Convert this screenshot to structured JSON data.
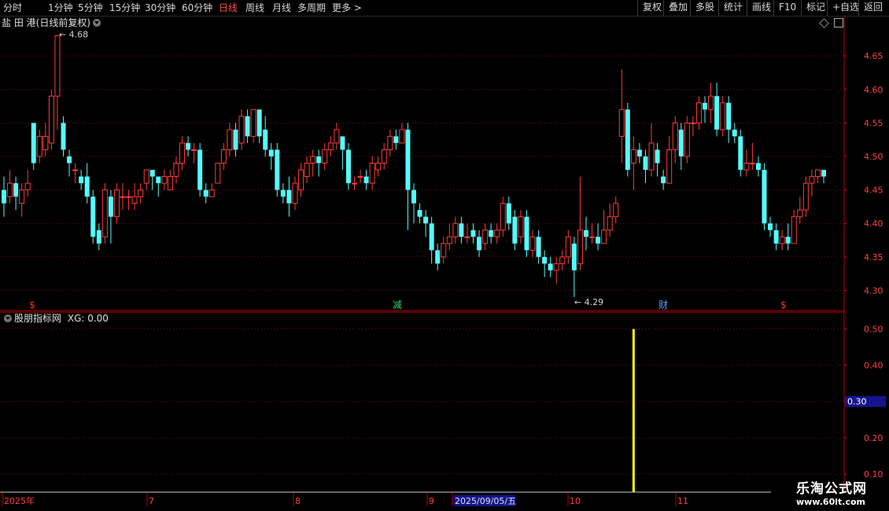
{
  "toolbar": {
    "periods": [
      "分时",
      "1分钟",
      "5分钟",
      "15分钟",
      "30分钟",
      "60分钟",
      "日线",
      "周线",
      "月线",
      "多周期",
      "更多"
    ],
    "active_period": "日线",
    "more_glyph": ">",
    "right_buttons": [
      "复权",
      "叠加",
      "多股",
      "统计",
      "画线",
      "F10",
      "标记",
      "+自选",
      "返回"
    ]
  },
  "main_chart": {
    "stock_name": "盐 田 港",
    "chart_mode": "(日线前复权)",
    "high_marker": "4.68",
    "low_marker": "4.29",
    "y_axis_ticks": [
      "4.65",
      "4.60",
      "4.55",
      "4.50",
      "4.45",
      "4.40",
      "4.35",
      "4.30"
    ],
    "event_markers": [
      {
        "text": "$",
        "color": "#ff3030"
      },
      {
        "text": "减",
        "color": "#35d56f"
      },
      {
        "text": "财",
        "color": "#4fa3ff"
      },
      {
        "text": "$",
        "color": "#ff3030"
      }
    ],
    "colors": {
      "up": "#ff3b3b",
      "down": "#54fcfc",
      "grid": "#7a1010",
      "axis": "#b40000"
    }
  },
  "indicator": {
    "name": "股朋指标网",
    "value_label": "XG: 0.00",
    "y_axis_ticks": [
      "0.50",
      "0.40",
      "0.30",
      "0.20",
      "0.10"
    ],
    "current_value_badge": "0.30",
    "signal_color": "#ffff00"
  },
  "date_axis": {
    "labels": [
      "2025年",
      "7",
      "8",
      "9",
      "2025/09/05/五",
      "10",
      "11"
    ]
  },
  "watermark": {
    "line1": "乐淘公式网",
    "line2": "www.60lt.com"
  },
  "chart_data": {
    "type": "candlestick",
    "y_range": [
      4.27,
      4.71
    ],
    "candles": [
      [
        4.45,
        4.43,
        4.47,
        4.41
      ],
      [
        4.44,
        4.46,
        4.48,
        4.43
      ],
      [
        4.46,
        4.44,
        4.47,
        4.42
      ],
      [
        4.43,
        4.45,
        4.46,
        4.41
      ],
      [
        4.45,
        4.46,
        4.48,
        4.44
      ],
      [
        4.55,
        4.49,
        4.55,
        4.48
      ],
      [
        4.5,
        4.53,
        4.54,
        4.49
      ],
      [
        4.51,
        4.53,
        4.55,
        4.5
      ],
      [
        4.52,
        4.59,
        4.6,
        4.51
      ],
      [
        4.59,
        4.68,
        4.68,
        4.54
      ],
      [
        4.55,
        4.51,
        4.56,
        4.5
      ],
      [
        4.5,
        4.49,
        4.51,
        4.47
      ],
      [
        4.48,
        4.48,
        4.49,
        4.46
      ],
      [
        4.47,
        4.46,
        4.48,
        4.45
      ],
      [
        4.47,
        4.44,
        4.49,
        4.43
      ],
      [
        4.44,
        4.38,
        4.45,
        4.37
      ],
      [
        4.39,
        4.37,
        4.4,
        4.36
      ],
      [
        4.38,
        4.45,
        4.46,
        4.37
      ],
      [
        4.44,
        4.41,
        4.45,
        4.37
      ],
      [
        4.41,
        4.45,
        4.46,
        4.4
      ],
      [
        4.44,
        4.44,
        4.46,
        4.42
      ],
      [
        4.44,
        4.44,
        4.45,
        4.42
      ],
      [
        4.43,
        4.44,
        4.46,
        4.42
      ],
      [
        4.44,
        4.45,
        4.46,
        4.43
      ],
      [
        4.46,
        4.48,
        4.48,
        4.45
      ],
      [
        4.48,
        4.47,
        4.48,
        4.45
      ],
      [
        4.47,
        4.46,
        4.47,
        4.44
      ],
      [
        4.46,
        4.47,
        4.48,
        4.45
      ],
      [
        4.45,
        4.47,
        4.48,
        4.45
      ],
      [
        4.47,
        4.49,
        4.5,
        4.46
      ],
      [
        4.49,
        4.52,
        4.53,
        4.48
      ],
      [
        4.52,
        4.51,
        4.53,
        4.5
      ],
      [
        4.51,
        4.51,
        4.52,
        4.49
      ],
      [
        4.51,
        4.45,
        4.52,
        4.44
      ],
      [
        4.45,
        4.44,
        4.46,
        4.43
      ],
      [
        4.44,
        4.45,
        4.46,
        4.44
      ],
      [
        4.46,
        4.49,
        4.49,
        4.46
      ],
      [
        4.49,
        4.51,
        4.52,
        4.48
      ],
      [
        4.51,
        4.54,
        4.55,
        4.5
      ],
      [
        4.54,
        4.51,
        4.55,
        4.5
      ],
      [
        4.52,
        4.56,
        4.57,
        4.51
      ],
      [
        4.56,
        4.53,
        4.57,
        4.52
      ],
      [
        4.53,
        4.57,
        4.57,
        4.52
      ],
      [
        4.57,
        4.53,
        4.57,
        4.52
      ],
      [
        4.54,
        4.51,
        4.56,
        4.5
      ],
      [
        4.51,
        4.5,
        4.52,
        4.48
      ],
      [
        4.51,
        4.45,
        4.52,
        4.44
      ],
      [
        4.45,
        4.44,
        4.46,
        4.43
      ],
      [
        4.45,
        4.43,
        4.47,
        4.41
      ],
      [
        4.43,
        4.46,
        4.47,
        4.42
      ],
      [
        4.45,
        4.48,
        4.49,
        4.44
      ],
      [
        4.47,
        4.49,
        4.5,
        4.46
      ],
      [
        4.49,
        4.5,
        4.51,
        4.47
      ],
      [
        4.5,
        4.49,
        4.51,
        4.47
      ],
      [
        4.49,
        4.51,
        4.52,
        4.48
      ],
      [
        4.51,
        4.52,
        4.53,
        4.5
      ],
      [
        4.52,
        4.54,
        4.55,
        4.51
      ],
      [
        4.53,
        4.51,
        4.53,
        4.48
      ],
      [
        4.51,
        4.46,
        4.52,
        4.45
      ],
      [
        4.46,
        4.46,
        4.47,
        4.45
      ],
      [
        4.47,
        4.47,
        4.48,
        4.46
      ],
      [
        4.47,
        4.46,
        4.48,
        4.45
      ],
      [
        4.46,
        4.49,
        4.5,
        4.45
      ],
      [
        4.48,
        4.49,
        4.5,
        4.47
      ],
      [
        4.49,
        4.51,
        4.52,
        4.48
      ],
      [
        4.51,
        4.53,
        4.54,
        4.5
      ],
      [
        4.53,
        4.52,
        4.54,
        4.51
      ],
      [
        4.52,
        4.54,
        4.55,
        4.52
      ],
      [
        4.54,
        4.45,
        4.55,
        4.39
      ],
      [
        4.45,
        4.43,
        4.46,
        4.4
      ],
      [
        4.42,
        4.41,
        4.43,
        4.4
      ],
      [
        4.41,
        4.4,
        4.42,
        4.38
      ],
      [
        4.4,
        4.36,
        4.41,
        4.34
      ],
      [
        4.36,
        4.34,
        4.37,
        4.33
      ],
      [
        4.35,
        4.37,
        4.38,
        4.34
      ],
      [
        4.37,
        4.38,
        4.4,
        4.36
      ],
      [
        4.38,
        4.4,
        4.41,
        4.37
      ],
      [
        4.4,
        4.38,
        4.41,
        4.37
      ],
      [
        4.38,
        4.38,
        4.4,
        4.37
      ],
      [
        4.39,
        4.38,
        4.4,
        4.37
      ],
      [
        4.38,
        4.36,
        4.39,
        4.35
      ],
      [
        4.37,
        4.39,
        4.4,
        4.36
      ],
      [
        4.39,
        4.38,
        4.4,
        4.37
      ],
      [
        4.38,
        4.39,
        4.4,
        4.37
      ],
      [
        4.39,
        4.43,
        4.44,
        4.38
      ],
      [
        4.43,
        4.4,
        4.44,
        4.39
      ],
      [
        4.41,
        4.37,
        4.42,
        4.36
      ],
      [
        4.38,
        4.41,
        4.42,
        4.37
      ],
      [
        4.41,
        4.36,
        4.42,
        4.35
      ],
      [
        4.36,
        4.38,
        4.39,
        4.35
      ],
      [
        4.38,
        4.35,
        4.39,
        4.34
      ],
      [
        4.35,
        4.34,
        4.36,
        4.32
      ],
      [
        4.34,
        4.33,
        4.35,
        4.32
      ],
      [
        4.33,
        4.34,
        4.35,
        4.31
      ],
      [
        4.34,
        4.35,
        4.36,
        4.33
      ],
      [
        4.35,
        4.38,
        4.39,
        4.34
      ],
      [
        4.37,
        4.33,
        4.38,
        4.29
      ],
      [
        4.34,
        4.39,
        4.47,
        4.33
      ],
      [
        4.39,
        4.38,
        4.41,
        4.36
      ],
      [
        4.38,
        4.38,
        4.4,
        4.37
      ],
      [
        4.38,
        4.37,
        4.4,
        4.36
      ],
      [
        4.37,
        4.39,
        4.42,
        4.37
      ],
      [
        4.39,
        4.41,
        4.43,
        4.38
      ],
      [
        4.41,
        4.43,
        4.44,
        4.4
      ],
      [
        4.53,
        4.57,
        4.63,
        4.49
      ],
      [
        4.57,
        4.48,
        4.58,
        4.47
      ],
      [
        4.49,
        4.51,
        4.53,
        4.45
      ],
      [
        4.51,
        4.5,
        4.52,
        4.49
      ],
      [
        4.5,
        4.48,
        4.51,
        4.46
      ],
      [
        4.48,
        4.52,
        4.55,
        4.47
      ],
      [
        4.51,
        4.49,
        4.52,
        4.47
      ],
      [
        4.47,
        4.46,
        4.48,
        4.45
      ],
      [
        4.46,
        4.51,
        4.53,
        4.46
      ],
      [
        4.51,
        4.55,
        4.56,
        4.49
      ],
      [
        4.54,
        4.5,
        4.55,
        4.48
      ],
      [
        4.5,
        4.55,
        4.56,
        4.49
      ],
      [
        4.55,
        4.55,
        4.56,
        4.53
      ],
      [
        4.55,
        4.58,
        4.59,
        4.54
      ],
      [
        4.58,
        4.57,
        4.59,
        4.55
      ],
      [
        4.57,
        4.59,
        4.61,
        4.55
      ],
      [
        4.59,
        4.54,
        4.61,
        4.53
      ],
      [
        4.54,
        4.58,
        4.59,
        4.53
      ],
      [
        4.58,
        4.54,
        4.59,
        4.52
      ],
      [
        4.54,
        4.53,
        4.55,
        4.52
      ],
      [
        4.53,
        4.48,
        4.54,
        4.47
      ],
      [
        4.48,
        4.49,
        4.51,
        4.47
      ],
      [
        4.49,
        4.49,
        4.52,
        4.48
      ],
      [
        4.49,
        4.48,
        4.5,
        4.47
      ],
      [
        4.48,
        4.4,
        4.49,
        4.39
      ],
      [
        4.4,
        4.39,
        4.41,
        4.38
      ],
      [
        4.39,
        4.37,
        4.4,
        4.36
      ],
      [
        4.37,
        4.38,
        4.39,
        4.36
      ],
      [
        4.38,
        4.37,
        4.4,
        4.36
      ],
      [
        4.37,
        4.41,
        4.42,
        4.37
      ],
      [
        4.41,
        4.42,
        4.44,
        4.4
      ],
      [
        4.42,
        4.46,
        4.47,
        4.41
      ],
      [
        4.46,
        4.47,
        4.48,
        4.44
      ],
      [
        4.47,
        4.48,
        4.48,
        4.46
      ],
      [
        4.48,
        4.47,
        4.48,
        4.46
      ]
    ],
    "indicator_signal": {
      "name": "XG",
      "value_at_signal": 0.5,
      "candle_index": 106
    }
  }
}
